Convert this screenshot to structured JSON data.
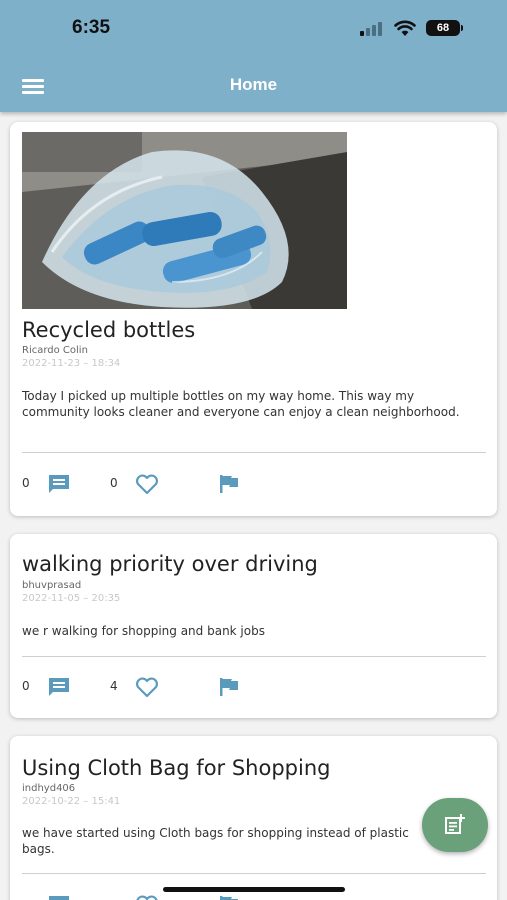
{
  "status_bar": {
    "time": "6:35",
    "battery": "68"
  },
  "header": {
    "title": "Home",
    "menu_icon": "hamburger-menu-icon"
  },
  "posts": [
    {
      "title": "Recycled bottles",
      "author": "Ricardo Colin",
      "date": "2022-11-23 – 18:34",
      "body": "Today I picked up multiple bottles on my way home. This way my community looks cleaner and everyone can enjoy a clean neighborhood.",
      "comments": "0",
      "likes": "0",
      "has_image": true
    },
    {
      "title": "walking priority over driving",
      "author": "bhuvprasad",
      "date": "2022-11-05 – 20:35",
      "body": "we r walking for shopping and bank jobs",
      "comments": "0",
      "likes": "4",
      "has_image": false
    },
    {
      "title": "Using Cloth Bag for Shopping",
      "author": "indhyd406",
      "date": "2022-10-22 – 15:41",
      "body": "we have started using  Cloth bags for shopping instead of plastic bags.",
      "comments": "",
      "likes": "",
      "has_image": false
    }
  ],
  "icons": {
    "comment": "comment-icon",
    "like": "heart-outline-icon",
    "flag": "flag-icon",
    "fab": "add-post-icon"
  },
  "colors": {
    "header": "#7fb0c9",
    "icon": "#5a9bbd",
    "fab": "#6aa07a",
    "date": "#c8c8c8"
  }
}
